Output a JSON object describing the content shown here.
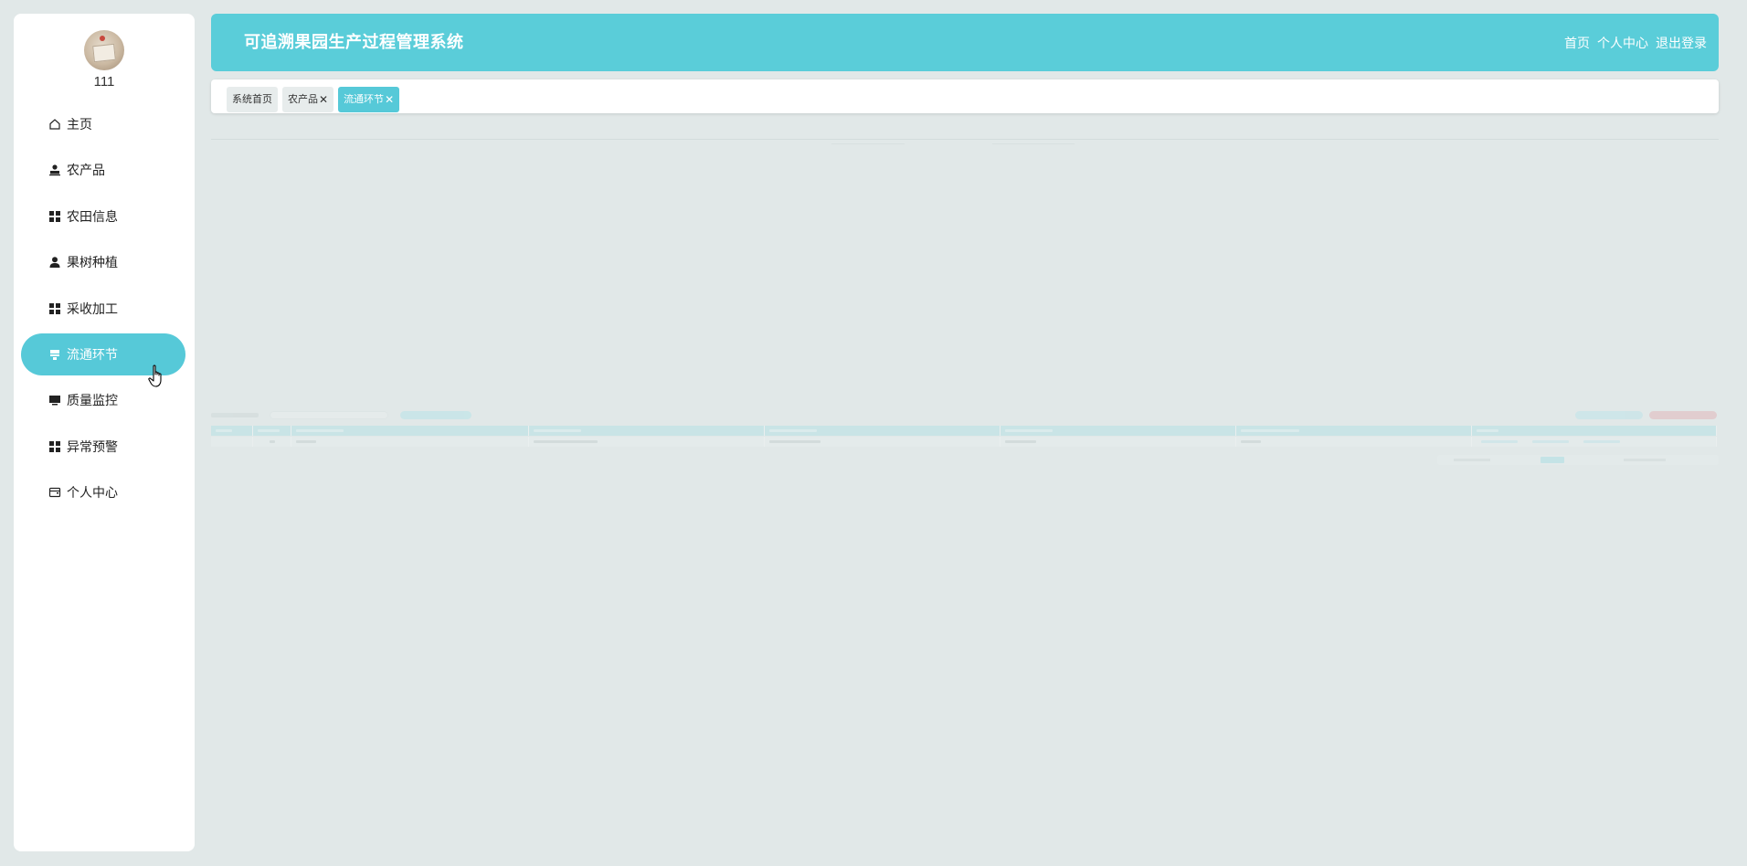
{
  "sidebar": {
    "username": "111",
    "items": [
      {
        "label": "主页",
        "icon": "home-icon"
      },
      {
        "label": "农产品",
        "icon": "user-badge-icon"
      },
      {
        "label": "农田信息",
        "icon": "grid-icon"
      },
      {
        "label": "果树种植",
        "icon": "person-icon"
      },
      {
        "label": "采收加工",
        "icon": "grid-icon"
      },
      {
        "label": "流通环节",
        "icon": "flow-icon",
        "active": true
      },
      {
        "label": "质量监控",
        "icon": "monitor-icon"
      },
      {
        "label": "异常预警",
        "icon": "grid-icon"
      },
      {
        "label": "个人中心",
        "icon": "wallet-icon"
      }
    ]
  },
  "header": {
    "title": "可追溯果园生产过程管理系统",
    "links": [
      "首页",
      "个人中心",
      "退出登录"
    ]
  },
  "tabs": [
    {
      "label": "系统首页",
      "closable": false
    },
    {
      "label": "农产品",
      "closable": true
    },
    {
      "label": "流通环节",
      "closable": true,
      "active": true
    }
  ],
  "colors": {
    "accent": "#56c9d8",
    "background": "#e1e8e8",
    "danger": "#e2b8bb"
  }
}
